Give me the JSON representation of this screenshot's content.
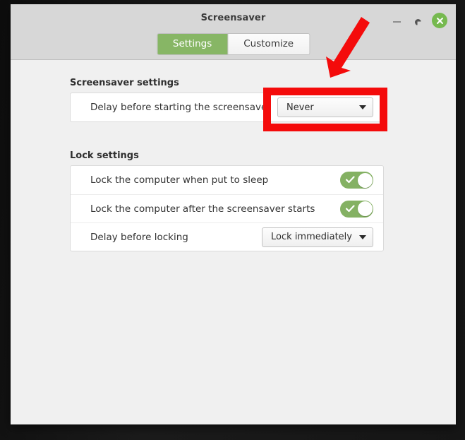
{
  "window": {
    "title": "Screensaver",
    "controls": {
      "minimize": "minimize",
      "maximize": "maximize",
      "close": "close"
    }
  },
  "tabs": [
    {
      "label": "Settings",
      "active": true
    },
    {
      "label": "Customize",
      "active": false
    }
  ],
  "sections": [
    {
      "title": "Screensaver settings",
      "rows": [
        {
          "label": "Delay before starting the screensaver",
          "control": "dropdown",
          "value": "Never"
        }
      ]
    },
    {
      "title": "Lock settings",
      "rows": [
        {
          "label": "Lock the computer when put to sleep",
          "control": "toggle",
          "value": "on"
        },
        {
          "label": "Lock the computer after the screensaver starts",
          "control": "toggle",
          "value": "on"
        },
        {
          "label": "Delay before locking",
          "control": "dropdown",
          "value": "Lock immediately"
        }
      ]
    }
  ],
  "annotations": {
    "highlight_color": "#f40b0b",
    "highlight_target": "Never",
    "arrow": "down-left-arrow"
  },
  "colors": {
    "accent_green": "#87b665",
    "toggle_green": "#84b163",
    "titlebar": "#d7d7d7",
    "content_bg": "#f0f0f0",
    "panel_bg": "#ffffff"
  }
}
